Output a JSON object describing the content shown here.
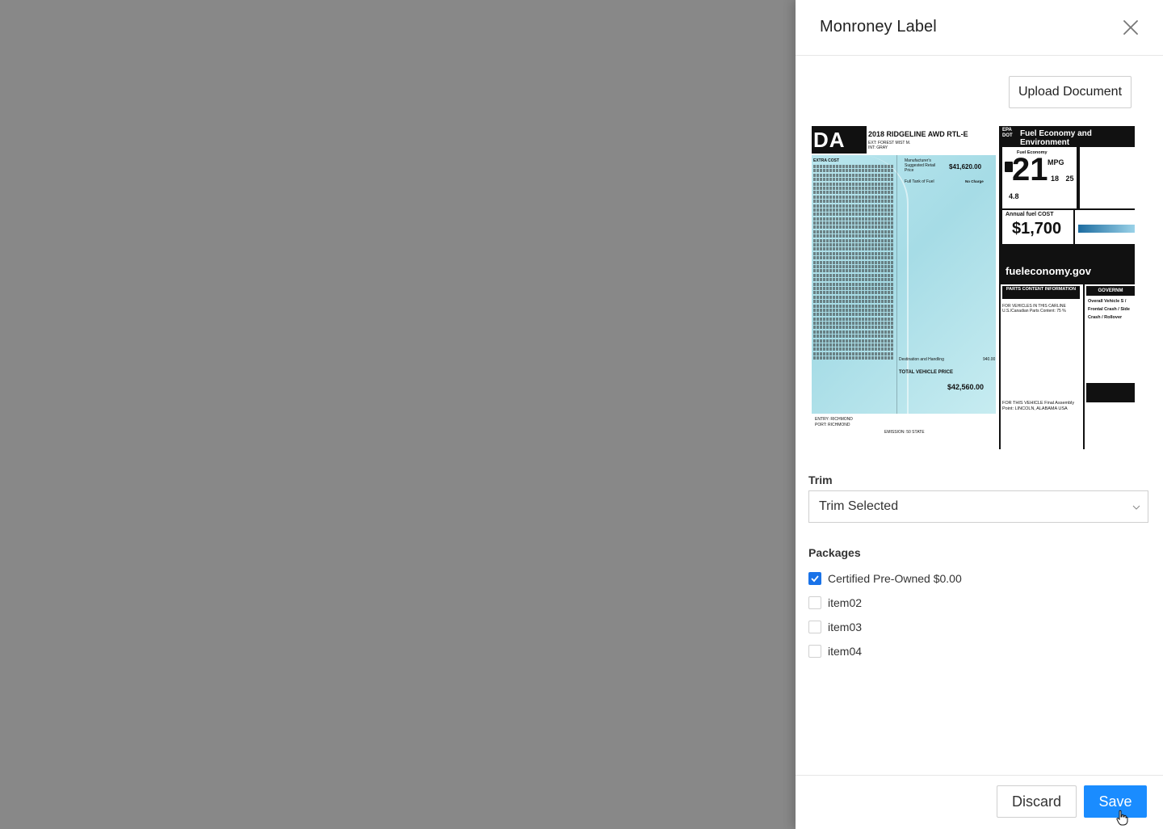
{
  "drawer": {
    "title": "Monroney Label",
    "upload_label": "Upload Document"
  },
  "sticker": {
    "brand": "DA",
    "model": "2018 RIDGELINE AWD RTL-E",
    "ext_color": "EXT: FOREST MIST M.",
    "int_color": "INT: GRAY",
    "extra_cost": "EXTRA COST",
    "msrp_label": "Manufacturer's Suggested Retail Price",
    "msrp": "$41,620.00",
    "full_tank": "Full Tank of Fuel",
    "no_charge": "No Charge",
    "destination": "Destination and Handling",
    "destination_value": "940.00",
    "total_label": "TOTAL VEHICLE PRICE",
    "total_price": "$42,560.00",
    "port_entry": "ENTRY: RICHMOND",
    "port": "PORT: RICHMOND",
    "emission": "EMISSION: 50 STATE",
    "epa_tag": "EPA DOT",
    "epa_title": "Fuel Economy and Environment",
    "fe_label": "Fuel Economy",
    "mpg_combined": "21",
    "mpg_unit": "MPG",
    "mpg_city_hwy": "18 25",
    "gallons": "4.8",
    "annual_cost_label": "Annual fuel COST",
    "annual_cost": "$1,700",
    "site": "fueleconomy.gov",
    "parts_title": "PARTS CONTENT INFORMATION",
    "parts_text": "FOR VEHICLES IN THIS CARLINE U.S./Canadian Parts Content: 75 %",
    "assembly": "FOR THIS VEHICLE Final Assembly Point: LINCOLN, ALABAMA USA",
    "gov_title": "GOVERNM",
    "gov_lines": "Overall Vehicle S / Frontal Crash / Side Crash / Rollover"
  },
  "form": {
    "trim_label": "Trim",
    "trim_value": "Trim Selected",
    "packages_label": "Packages",
    "packages": [
      {
        "label": "Certified Pre-Owned $0.00",
        "checked": true
      },
      {
        "label": "item02",
        "checked": false
      },
      {
        "label": "item03",
        "checked": false
      },
      {
        "label": "item04",
        "checked": false
      }
    ]
  },
  "footer": {
    "discard_label": "Discard",
    "save_label": "Save"
  },
  "colors": {
    "primary": "#1a8cff",
    "overlay": "#888888",
    "checkbox": "#1a73e8"
  },
  "icons": [
    "close-icon",
    "chevron-down-icon",
    "check-icon",
    "pointer-cursor-icon"
  ]
}
